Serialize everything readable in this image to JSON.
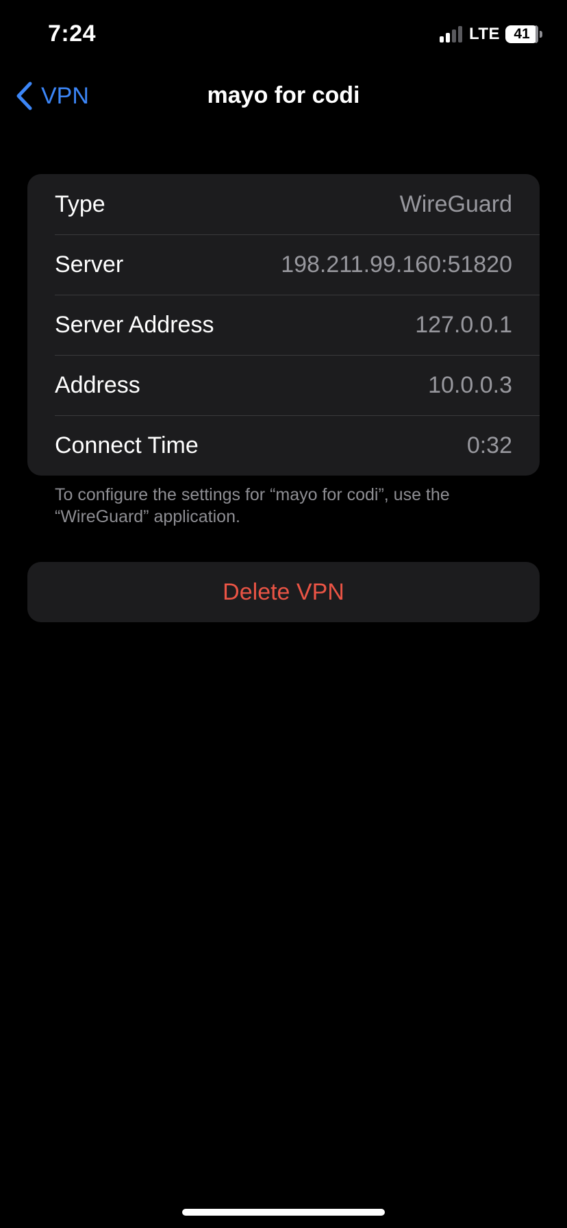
{
  "status_bar": {
    "time": "7:24",
    "network": "LTE",
    "battery": "41",
    "signal_bars_active": 2,
    "signal_bars_total": 4
  },
  "nav": {
    "back_label": "VPN",
    "title": "mayo for codi"
  },
  "details": {
    "rows": [
      {
        "label": "Type",
        "value": "WireGuard"
      },
      {
        "label": "Server",
        "value": "198.211.99.160:51820"
      },
      {
        "label": "Server Address",
        "value": "127.0.0.1"
      },
      {
        "label": "Address",
        "value": "10.0.0.3"
      },
      {
        "label": "Connect Time",
        "value": "0:32"
      }
    ],
    "footnote": "To configure the settings for “mayo for codi”, use the “WireGuard” application."
  },
  "actions": {
    "delete_label": "Delete VPN"
  },
  "colors": {
    "accent": "#3c86f7",
    "destructive": "#ea5445",
    "group_background": "#1c1c1e",
    "secondary_text": "#98989e"
  }
}
